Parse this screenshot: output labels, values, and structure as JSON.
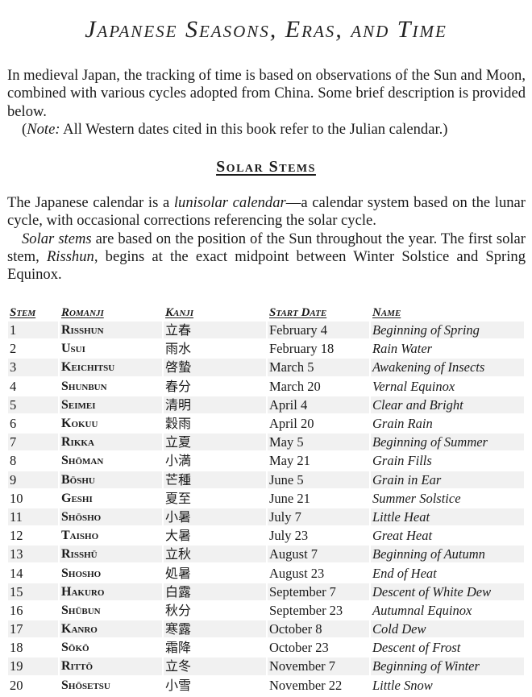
{
  "title": "Japanese Seasons, Eras, and Time",
  "intro": {
    "paragraph": "In medieval Japan, the tracking of time is based on observations of the Sun and Moon, combined with various cycles adopted from China. Some brief description is provided below.",
    "note_label": "Note:",
    "note_text": " All Western dates cited in this book refer to the Julian calendar.)",
    "note_open": "("
  },
  "section": {
    "heading": "Solar Stems",
    "p1_a": "The Japanese calendar is a ",
    "p1_em": "lunisolar calendar",
    "p1_b": "—a calendar system based on the lunar cycle, with occasional corrections referencing the solar cycle.",
    "p2_em1": "Solar stems",
    "p2_a": " are based on the position of the Sun throughout the year. The first solar stem, ",
    "p2_em2": "Risshun",
    "p2_b": ", begins at the exact midpoint between Winter Solstice and Spring Equinox."
  },
  "table": {
    "headers": [
      "Stem",
      "Romanji",
      "Kanji",
      "Start Date",
      "Name"
    ],
    "rows": [
      {
        "stem": "1",
        "romanji": "Risshun",
        "kanji": "立春",
        "date": "February 4",
        "name": "Beginning of Spring"
      },
      {
        "stem": "2",
        "romanji": "Usui",
        "kanji": "雨水",
        "date": "February 18",
        "name": "Rain Water"
      },
      {
        "stem": "3",
        "romanji": "Keichitsu",
        "kanji": "啓蟄",
        "date": "March 5",
        "name": "Awakening of Insects"
      },
      {
        "stem": "4",
        "romanji": "Shunbun",
        "kanji": "春分",
        "date": "March 20",
        "name": "Vernal Equinox"
      },
      {
        "stem": "5",
        "romanji": "Seimei",
        "kanji": "清明",
        "date": "April 4",
        "name": "Clear and Bright"
      },
      {
        "stem": "6",
        "romanji": "Kokuu",
        "kanji": "穀雨",
        "date": "April 20",
        "name": "Grain Rain"
      },
      {
        "stem": "7",
        "romanji": "Rikka",
        "kanji": "立夏",
        "date": "May 5",
        "name": "Beginning of Summer"
      },
      {
        "stem": "8",
        "romanji": "Shōman",
        "kanji": "小満",
        "date": "May 21",
        "name": "Grain Fills"
      },
      {
        "stem": "9",
        "romanji": "Bōshu",
        "kanji": "芒種",
        "date": "June 5",
        "name": "Grain in Ear"
      },
      {
        "stem": "10",
        "romanji": "Geshi",
        "kanji": "夏至",
        "date": "June 21",
        "name": "Summer Solstice"
      },
      {
        "stem": "11",
        "romanji": "Shōsho",
        "kanji": "小暑",
        "date": "July 7",
        "name": "Little Heat"
      },
      {
        "stem": "12",
        "romanji": "Taisho",
        "kanji": "大暑",
        "date": "July 23",
        "name": "Great Heat"
      },
      {
        "stem": "13",
        "romanji": "Risshū",
        "kanji": "立秋",
        "date": "August 7",
        "name": "Beginning of Autumn"
      },
      {
        "stem": "14",
        "romanji": "Shosho",
        "kanji": "処暑",
        "date": "August 23",
        "name": "End of Heat"
      },
      {
        "stem": "15",
        "romanji": "Hakuro",
        "kanji": "白露",
        "date": "September 7",
        "name": "Descent of White Dew"
      },
      {
        "stem": "16",
        "romanji": "Shūbun",
        "kanji": "秋分",
        "date": "September 23",
        "name": "Autumnal Equinox"
      },
      {
        "stem": "17",
        "romanji": "Kanro",
        "kanji": "寒露",
        "date": "October 8",
        "name": "Cold Dew"
      },
      {
        "stem": "18",
        "romanji": "Sōkō",
        "kanji": "霜降",
        "date": "October 23",
        "name": "Descent of Frost"
      },
      {
        "stem": "19",
        "romanji": "Rittō",
        "kanji": "立冬",
        "date": "November 7",
        "name": "Beginning of Winter"
      },
      {
        "stem": "20",
        "romanji": "Shōsetsu",
        "kanji": "小雪",
        "date": "November 22",
        "name": "Little Snow"
      }
    ]
  },
  "colors": {
    "row_shade": "#f1f1f1",
    "text": "#1a1a1a"
  }
}
